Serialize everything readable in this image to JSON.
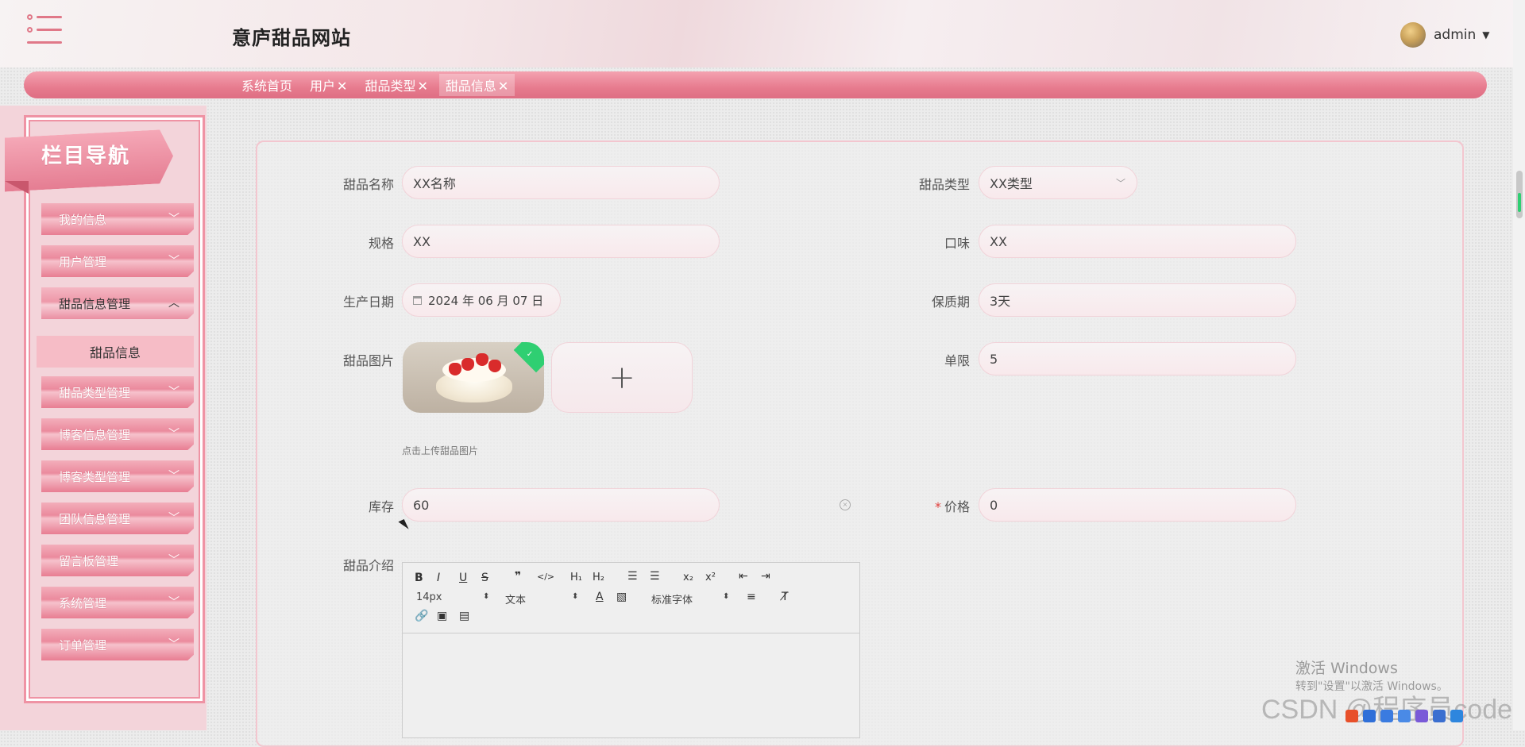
{
  "header": {
    "site_title": "意庐甜品网站",
    "user_name": "admin"
  },
  "tabs": [
    {
      "label": "系统首页",
      "closable": false
    },
    {
      "label": "用户",
      "closable": true
    },
    {
      "label": "甜品类型",
      "closable": true
    },
    {
      "label": "甜品信息",
      "closable": true,
      "active": true
    }
  ],
  "sidebar": {
    "banner": "栏目导航",
    "items": [
      {
        "label": "我的信息"
      },
      {
        "label": "用户管理"
      },
      {
        "label": "甜品信息管理",
        "open": true
      },
      {
        "label": "甜品类型管理"
      },
      {
        "label": "博客信息管理"
      },
      {
        "label": "博客类型管理"
      },
      {
        "label": "团队信息管理"
      },
      {
        "label": "留言板管理"
      },
      {
        "label": "系统管理"
      },
      {
        "label": "订单管理"
      }
    ],
    "sub_item": "甜品信息"
  },
  "form": {
    "name": {
      "label": "甜品名称",
      "value": "XX名称"
    },
    "type": {
      "label": "甜品类型",
      "value": "XX类型"
    },
    "spec": {
      "label": "规格",
      "value": "XX"
    },
    "flavor": {
      "label": "口味",
      "value": "XX"
    },
    "date": {
      "label": "生产日期",
      "value": "2024 年 06 月 07 日"
    },
    "shelf": {
      "label": "保质期",
      "value": "3天"
    },
    "image": {
      "label": "甜品图片",
      "tip": "点击上传甜品图片"
    },
    "limit": {
      "label": "单限",
      "value": "5"
    },
    "stock": {
      "label": "库存",
      "value": "60"
    },
    "price": {
      "label": "价格",
      "required_mark": "*",
      "value": "0"
    },
    "intro": {
      "label": "甜品介绍"
    }
  },
  "editor": {
    "font_size": "14px",
    "paragraph": "文本",
    "font_family": "标准字体",
    "buttons_row1": [
      "B",
      "I",
      "U",
      "S",
      "❞",
      "</>",
      "H1",
      "H2",
      "ol",
      "ul",
      "x₂",
      "x²",
      "outdent",
      "indent"
    ]
  },
  "watermark": {
    "line1": "激活 Windows",
    "line2": "转到\"设置\"以激活 Windows。",
    "csdn": "CSDN @程序员code"
  }
}
